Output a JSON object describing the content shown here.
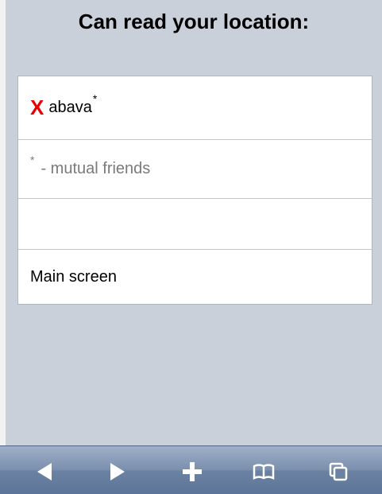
{
  "header": {
    "title": "Can read your location:"
  },
  "list": {
    "friend": {
      "remove_glyph": "X",
      "name": "abava",
      "marker": "*"
    },
    "note": {
      "marker": "*",
      "text": "- mutual friends"
    },
    "main": {
      "label": "Main screen"
    }
  },
  "toolbar": {
    "items": [
      {
        "icon": "back-arrow-icon"
      },
      {
        "icon": "forward-arrow-icon"
      },
      {
        "icon": "plus-icon"
      },
      {
        "icon": "bookmarks-icon"
      },
      {
        "icon": "pages-icon"
      }
    ]
  },
  "colors": {
    "remove": "#e60000",
    "background": "#c9d0d9",
    "toolbar": "#6b82a3"
  }
}
